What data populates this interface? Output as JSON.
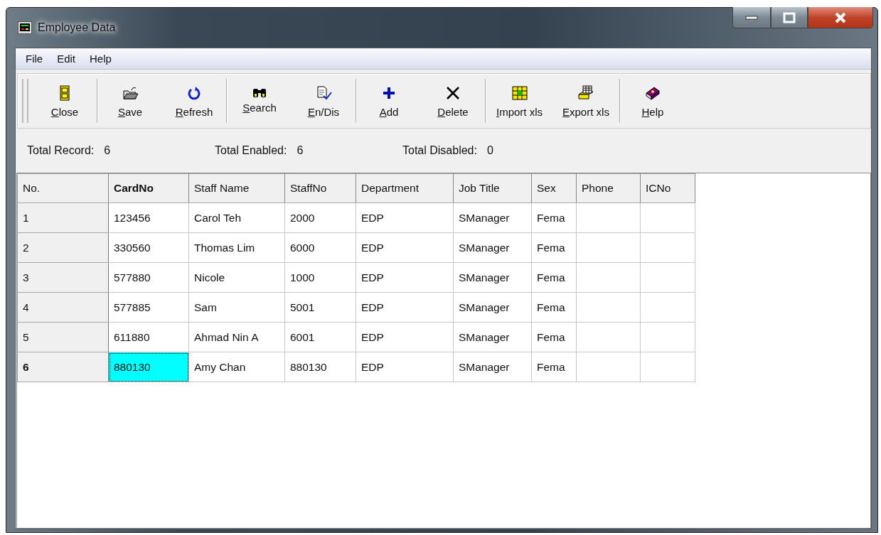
{
  "window": {
    "title": "Employee Data"
  },
  "menu": [
    "File",
    "Edit",
    "Help"
  ],
  "toolbar": [
    [
      "Close"
    ],
    [
      "Save",
      "Refresh"
    ],
    [
      "Search",
      "En/Dis"
    ],
    [
      "Add",
      "Delete"
    ],
    [
      "Import xls",
      "Export xls"
    ],
    [
      "Help"
    ]
  ],
  "stats": [
    {
      "label": "Total Record:",
      "value": "6"
    },
    {
      "label": "Total Enabled:",
      "value": "6"
    },
    {
      "label": "Total Disabled:",
      "value": "0"
    }
  ],
  "table": {
    "columns": [
      {
        "label": "No.",
        "selected": false
      },
      {
        "label": "CardNo",
        "selected": true
      },
      {
        "label": "Staff Name",
        "selected": false
      },
      {
        "label": "StaffNo",
        "selected": false
      },
      {
        "label": "Department",
        "selected": false
      },
      {
        "label": "Job Title",
        "selected": false
      },
      {
        "label": "Sex",
        "selected": false
      },
      {
        "label": "Phone",
        "selected": false
      },
      {
        "label": "ICNo",
        "selected": false
      }
    ],
    "rows": [
      {
        "selected": false,
        "cells": [
          "1",
          "123456",
          "Carol Teh",
          "2000",
          "EDP",
          "SManager",
          "Fema",
          "",
          ""
        ]
      },
      {
        "selected": false,
        "cells": [
          "2",
          "330560",
          "Thomas Lim",
          "6000",
          "EDP",
          "SManager",
          "Fema",
          "",
          ""
        ]
      },
      {
        "selected": false,
        "cells": [
          "3",
          "577880",
          "Nicole",
          "1000",
          "EDP",
          "SManager",
          "Fema",
          "",
          ""
        ]
      },
      {
        "selected": false,
        "cells": [
          "4",
          "577885",
          "Sam",
          "5001",
          "EDP",
          "SManager",
          "Fema",
          "",
          ""
        ]
      },
      {
        "selected": false,
        "cells": [
          "5",
          "611880",
          "Ahmad Nin A",
          "6001",
          "EDP",
          "SManager",
          "Fema",
          "",
          ""
        ]
      },
      {
        "selected": true,
        "cells": [
          "6",
          "880130",
          "Amy Chan",
          "880130",
          "EDP",
          "SManager",
          "Fema",
          "",
          ""
        ]
      }
    ]
  }
}
